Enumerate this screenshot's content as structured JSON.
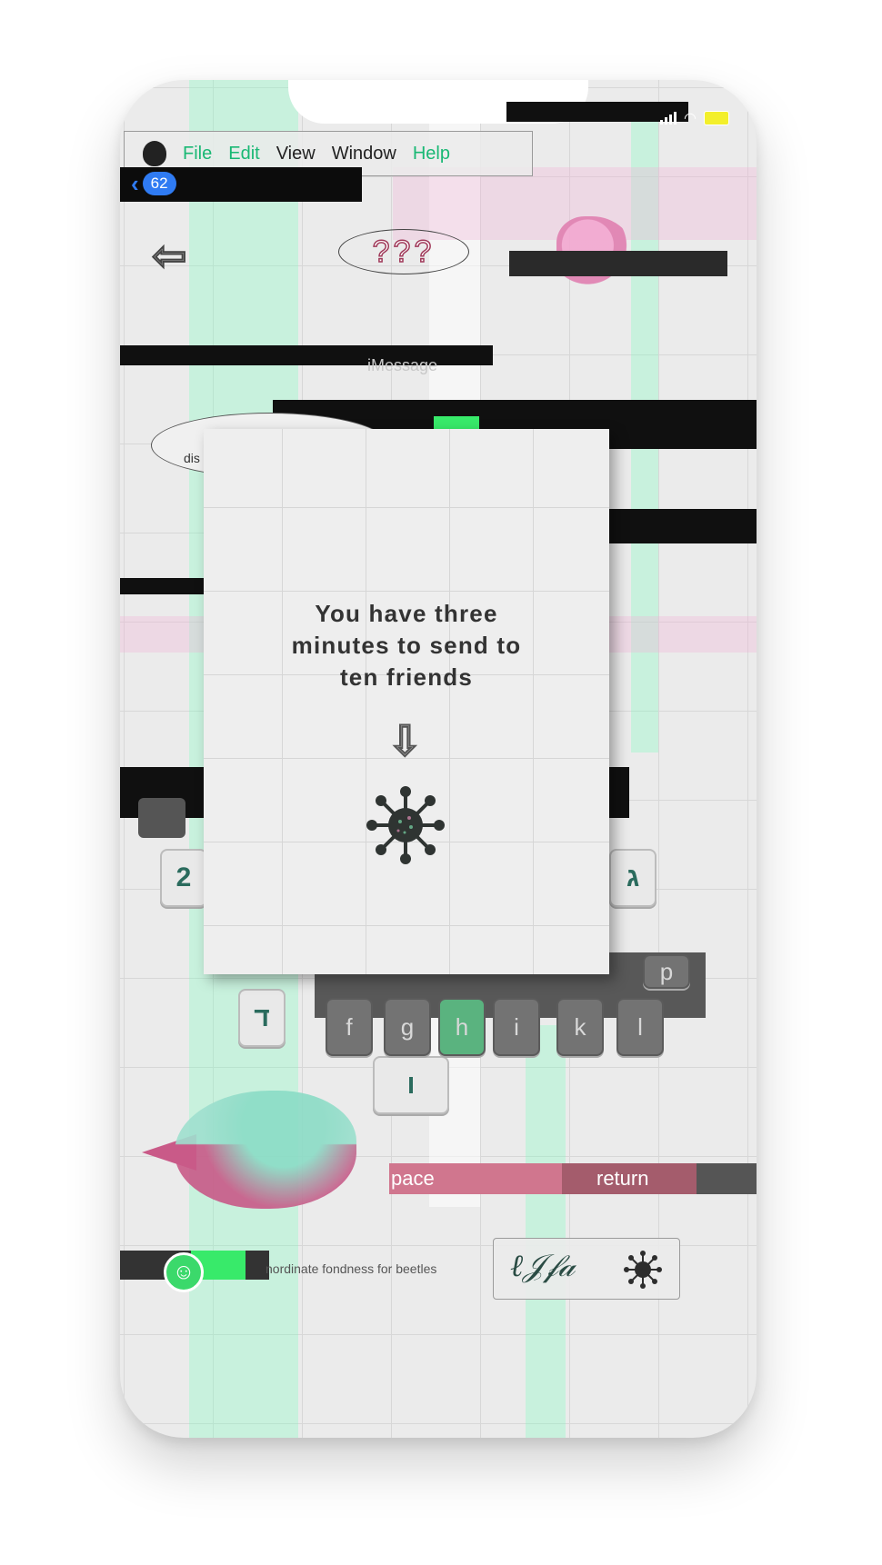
{
  "menubar": {
    "items": [
      "File",
      "Edit",
      "View",
      "Window",
      "Help"
    ]
  },
  "nav": {
    "back_count": "62"
  },
  "header": {
    "title": "???"
  },
  "thread": {
    "label": "iMessage",
    "bubble_text": "dis"
  },
  "modal": {
    "title": "You have three minutes to send to ten friends"
  },
  "keyboard": {
    "glyph_keys": [
      "2",
      "ג",
      "ד",
      "ו"
    ],
    "letter_keys": [
      "f",
      "g",
      "h",
      "i",
      "k",
      "l"
    ],
    "top_right_key": "p",
    "space_label": "pace",
    "return_label": "return"
  },
  "input": {
    "status_text": "nordinate fondness for beetles"
  },
  "colors": {
    "glitch_green": "#38ea6a",
    "ios_blue": "#2f7bf3",
    "space_pink": "#d0768e"
  },
  "icons": [
    "apple-logo",
    "back-chevron-icon",
    "back-arrow-icon",
    "phone-icon",
    "camera-icon",
    "down-arrow-icon",
    "virus-icon",
    "emoji-icon",
    "signature-sticker"
  ]
}
